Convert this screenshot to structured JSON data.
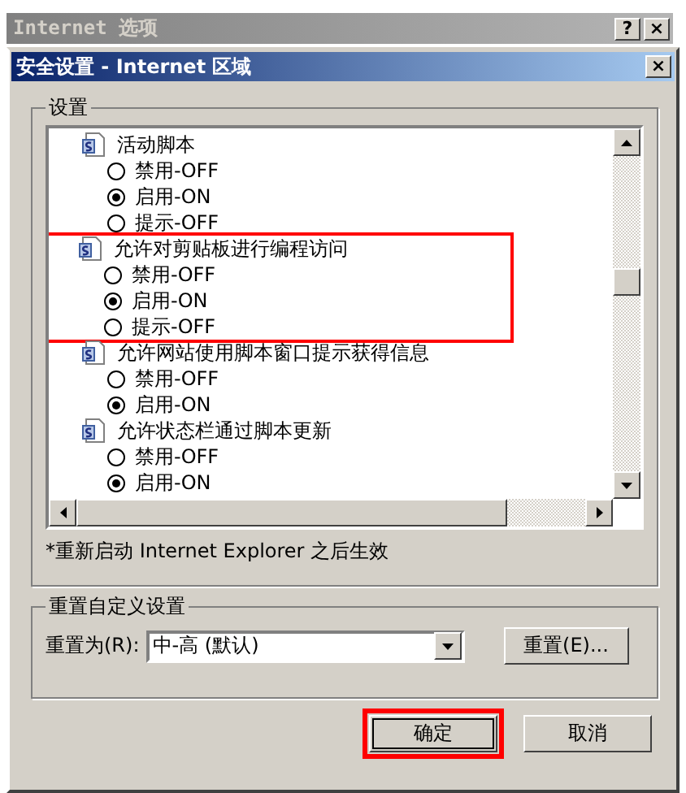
{
  "outer_window": {
    "title": "Internet 选项",
    "buttons": [
      "?",
      "×"
    ]
  },
  "dialog": {
    "title": "安全设置 - Internet 区域",
    "close": "×",
    "settings": {
      "label": "设置",
      "items": [
        {
          "title": "活动脚本",
          "highlighted": false,
          "options": [
            {
              "label": "禁用-OFF",
              "selected": false
            },
            {
              "label": "启用-ON",
              "selected": true
            },
            {
              "label": "提示-OFF",
              "selected": false
            }
          ]
        },
        {
          "title": "允许对剪贴板进行编程访问",
          "highlighted": true,
          "options": [
            {
              "label": "禁用-OFF",
              "selected": false
            },
            {
              "label": "启用-ON",
              "selected": true
            },
            {
              "label": "提示-OFF",
              "selected": false
            }
          ]
        },
        {
          "title": "允许网站使用脚本窗口提示获得信息",
          "highlighted": false,
          "options": [
            {
              "label": "禁用-OFF",
              "selected": false
            },
            {
              "label": "启用-ON",
              "selected": true
            }
          ]
        },
        {
          "title": "允许状态栏通过脚本更新",
          "highlighted": false,
          "options": [
            {
              "label": "禁用-OFF",
              "selected": false
            },
            {
              "label": "启用-ON",
              "selected": true
            }
          ]
        }
      ],
      "note": "*重新启动 Internet Explorer 之后生效"
    },
    "reset": {
      "label": "重置自定义设置",
      "field_label": "重置为(R):",
      "value": "中-高 (默认)",
      "button": "重置(E)..."
    },
    "buttons": [
      {
        "label": "确定",
        "highlighted": true
      },
      {
        "label": "取消",
        "highlighted": false
      }
    ]
  }
}
